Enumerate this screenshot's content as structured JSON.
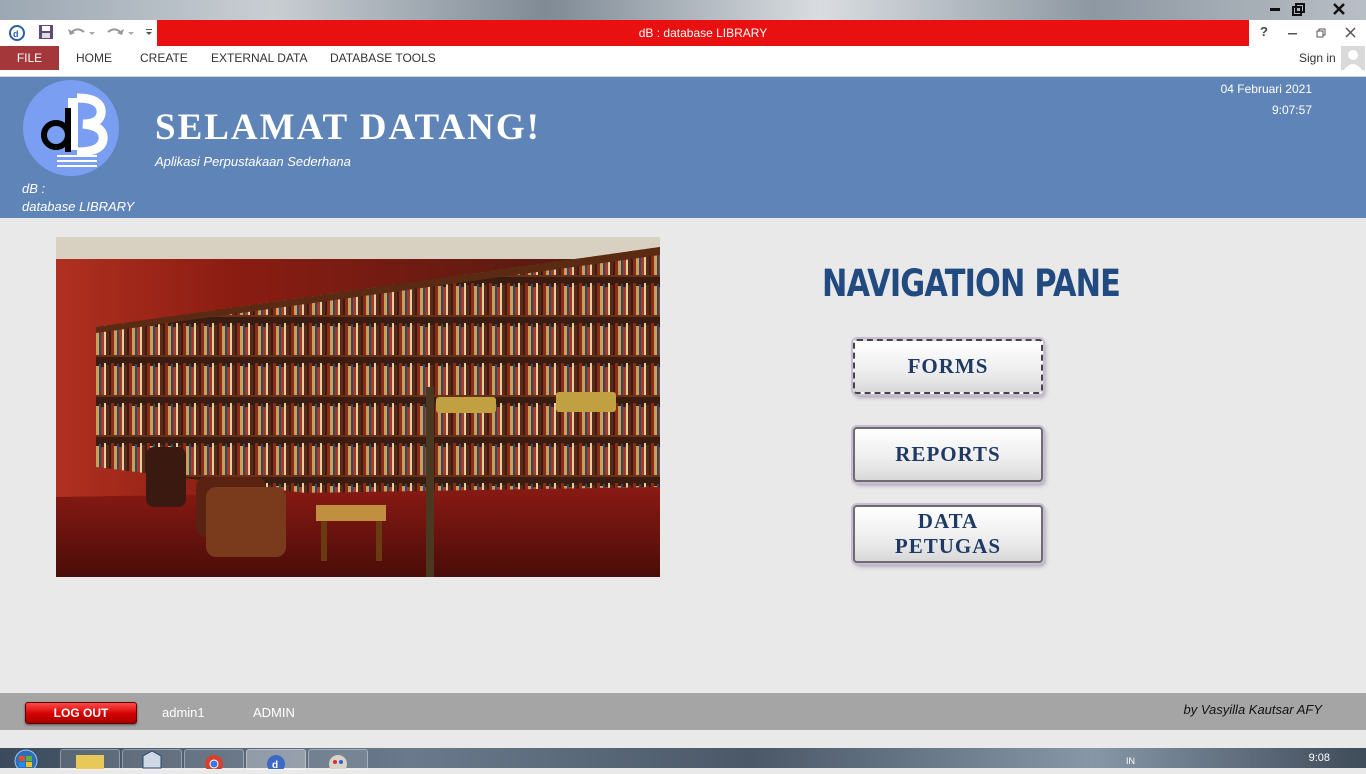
{
  "window": {
    "title": "dB : database LIBRARY",
    "help": "?",
    "sign_in": "Sign in"
  },
  "ribbon": {
    "tabs": [
      "FILE",
      "HOME",
      "CREATE",
      "EXTERNAL DATA",
      "DATABASE TOOLS"
    ]
  },
  "header": {
    "logo_letters": "dB",
    "welcome": "SELAMAT DATANG!",
    "subtitle": "Aplikasi Perpustakaan Sederhana",
    "app_name_line1": "dB :",
    "app_name_line2": "database LIBRARY",
    "date": "04 Februari 2021",
    "time": "9:07:57"
  },
  "navigation": {
    "title": "NAVIGATION PANE",
    "buttons": [
      {
        "label": "FORMS"
      },
      {
        "label": "REPORTS"
      },
      {
        "label_line1": "DATA",
        "label_line2": "PETUGAS"
      }
    ]
  },
  "footer": {
    "logout_label": "LOG OUT",
    "username": "admin1",
    "role": "ADMIN",
    "credit": "by Vasyilla Kautsar AFY"
  },
  "taskbar": {
    "lang": "IN",
    "clock": "9:08"
  },
  "colors": {
    "title_bar": "#e81010",
    "header_bg": "#5f84b7",
    "file_tab": "#a4373a",
    "nav_title": "#214a80",
    "logout": "#d40000"
  }
}
